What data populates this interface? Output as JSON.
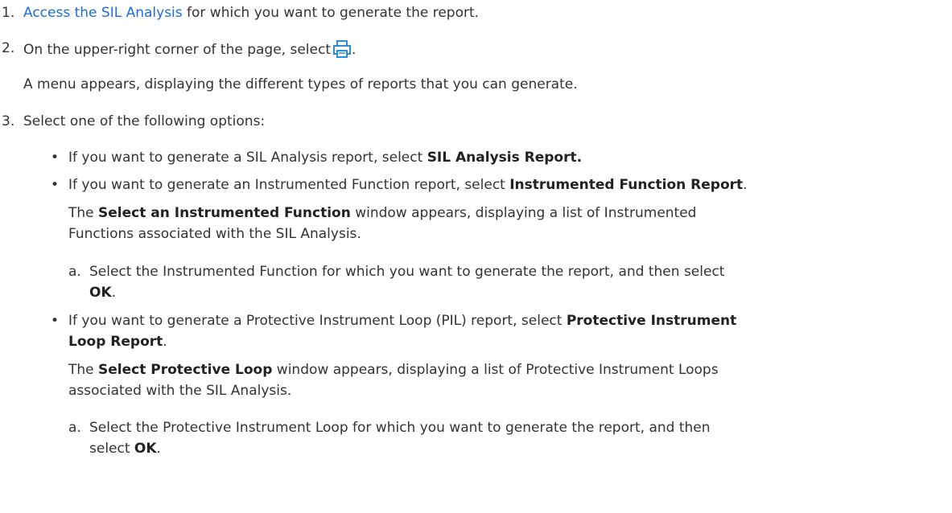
{
  "steps": {
    "s1": {
      "num": "1.",
      "link": "Access the SIL Analysis",
      "text": " for which you want to generate the report."
    },
    "s2": {
      "num": "2.",
      "text": "On the upper-right corner of the page, select",
      "after_icon": ".",
      "icon": "printer-icon",
      "result": "A menu appears, displaying the different types of reports that you can generate."
    },
    "s3": {
      "num": "3.",
      "text": "Select one of the following options:"
    }
  },
  "options": {
    "o1": {
      "bullet": "•",
      "text": "If you want to generate a SIL Analysis report, select ",
      "bold": "SIL Analysis Report."
    },
    "o2": {
      "bullet": "•",
      "text": "If you want to generate an Instrumented Function report, select ",
      "bold": "Instrumented Function Report",
      "end": ".",
      "result_pre": "The ",
      "result_bold": "Select an Instrumented Function",
      "result_post_1": " window appears, displaying a list of Instrumented",
      "result_post_2": "Functions associated with the SIL Analysis.",
      "sub_label": "a.",
      "sub_text_1": "Select the Instrumented Function for which you want to generate the report, and then select",
      "sub_bold": "OK",
      "sub_end": "."
    },
    "o3": {
      "bullet": "•",
      "text": "If you want to generate a Protective Instrument Loop (PIL) report, select ",
      "bold_1": "Protective Instrument",
      "bold_2": "Loop Report",
      "end": ".",
      "result_pre": "The ",
      "result_bold": "Select Protective Loop",
      "result_post_1": " window appears, displaying a list of Protective Instrument Loops",
      "result_post_2": "associated with the SIL Analysis.",
      "sub_label": "a.",
      "sub_text_1": "Select the Protective Instrument Loop for which you want to generate the report, and then",
      "sub_text_2": "select ",
      "sub_bold": "OK",
      "sub_end": "."
    }
  },
  "colors": {
    "link": "#1a6fdb",
    "icon": "#2a8fd8",
    "text": "#333333"
  }
}
